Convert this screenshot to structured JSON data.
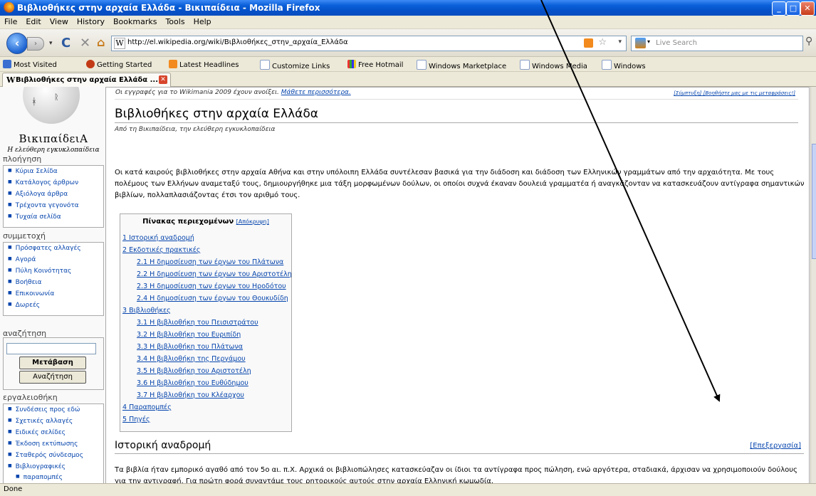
{
  "window": {
    "title": "Βιβλιοθήκες στην αρχαία Ελλάδα - Βικιπαίδεια - Mozilla Firefox",
    "minimize_glyph": "_",
    "maximize_glyph": "□",
    "close_glyph": "✕"
  },
  "menu": [
    "File",
    "Edit",
    "View",
    "History",
    "Bookmarks",
    "Tools",
    "Help"
  ],
  "nav": {
    "url": "http://el.wikipedia.org/wiki/Βιβλιοθήκες_στην_αρχαία_Ελλάδα",
    "search_placeholder": "Live Search",
    "favicon": "W"
  },
  "bookmarks": [
    "Most Visited",
    "Getting Started",
    "Latest Headlines",
    "Customize Links",
    "Free Hotmail",
    "Windows Marketplace",
    "Windows Media",
    "Windows"
  ],
  "tab": {
    "title": "Βιβλιοθήκες στην αρχαία Ελλάδα ...",
    "favicon": "W"
  },
  "sidebar": {
    "site_name": "ΒικιπαίδειΑ",
    "tagline": "Η ελεύθερη εγκυκλοπαίδεια",
    "nav_heading": "πλοήγηση",
    "nav_items": [
      "Κύρια Σελίδα",
      "Κατάλογος άρθρων",
      "Αξιόλογα άρθρα",
      "Τρέχοντα γεγονότα",
      "Τυχαία σελίδα"
    ],
    "participate_heading": "συμμετοχή",
    "participate_items": [
      "Πρόσφατες αλλαγές",
      "Αγορά",
      "Πύλη Κοινότητας",
      "Βοήθεια",
      "Επικοινωνία",
      "Δωρεές"
    ],
    "search_heading": "αναζήτηση",
    "go_button": "Μετάβαση",
    "search_button": "Αναζήτηση",
    "toolbox_heading": "εργαλειοθήκη",
    "toolbox_items": [
      "Συνδέσεις προς εδώ",
      "Σχετικές αλλαγές",
      "Ειδικές σελίδες",
      "Έκδοση εκτύπωσης",
      "Σταθερός σύνδεσμος",
      "Βιβλιογραφικές"
    ],
    "toolbox_tail": "παραπομπές"
  },
  "notice": {
    "text": "Οι εγγραφές για το Wikimania 2009 έχουν ανοίξει. ",
    "link": "Μάθετε περισσότερα.",
    "right": "[Σύμπτυξη] [Βοηθήστε μας με τις μεταφράσεις!]"
  },
  "article": {
    "title": "Βιβλιοθήκες στην αρχαία Ελλάδα",
    "subtitle": "Από τη Βικιπαίδεια, την ελεύθερη εγκυκλοπαίδεια",
    "intro": "Οι κατά καιρούς βιβλιοθήκες στην αρχαία Αθήνα και στην υπόλοιπη Ελλάδα συντέλεσαν βασικά για την διάδοση και διάδοση των Ελληνικών γραμμάτων από την αρχαιότητα. Με τους πολέμους των Ελλήνων αναμεταξύ τους, δημιουργήθηκε μια τάξη μορφωμένων δούλων, οι οποίοι συχνά έκαναν δουλειά γραμματέα ή αναγκάζονταν να κατασκευάζουν αντίγραφα σημαντικών βιβλίων, πολλαπλασιάζοντας έτσι τον αριθμό τους.",
    "toc_title": "Πίνακας περιεχομένων",
    "toc_hide": "[Απόκρυψη]",
    "toc": [
      "1 Ιστορική αναδρομή",
      "2 Εκδοτικές πρακτικές",
      "2.1 Η δημοσίευση των έργων του Πλάτωνα",
      "2.2 Η δημοσίευση των έργων του Αριστοτέλη",
      "2.3 Η δημοσίευση των έργων του Ηροδότου",
      "2.4 Η δημοσίευση των έργων του Θουκυδίδη",
      "3 Βιβλιοθήκες",
      "3.1 Η βιβλιοθήκη του Πεισιστράτου",
      "3.2 Η βιβλιοθήκη του Ευριπίδη",
      "3.3 Η βιβλιοθήκη του Πλάτωνα",
      "3.4 Η βιβλιοθήκη της Περγάμου",
      "3.5 Η βιβλιοθήκη του Αριστοτέλη",
      "3.6 Η βιβλιοθήκη του Ευθύδημου",
      "3.7 Η βιβλιοθήκη του Κλέαρχου",
      "4 Παραπομπές",
      "5 Πηγές"
    ],
    "section_title": "Ιστορική αναδρομή",
    "section_edit": "[Επεξεργασία]",
    "section_text": "Τα βιβλία ήταν εμπορικό αγαθό από τον 5ο αι. π.Χ. Αρχικά οι βιβλιοπώλησες κατασκεύαζαν οι ίδιοι τα αντίγραφα προς πώληση, ενώ αργότερα, σταδιακά, άρχισαν να χρησιμοποιούν δούλους για την αντιγραφή. Για πρώτη φορά συναντάμε τους ρητορικούς αυτούς στην αρχαία Ελληνική κωμωδία."
  },
  "status": "Done",
  "colors": {
    "link": "#0645ad",
    "titlebar": "#0a5fd8"
  }
}
